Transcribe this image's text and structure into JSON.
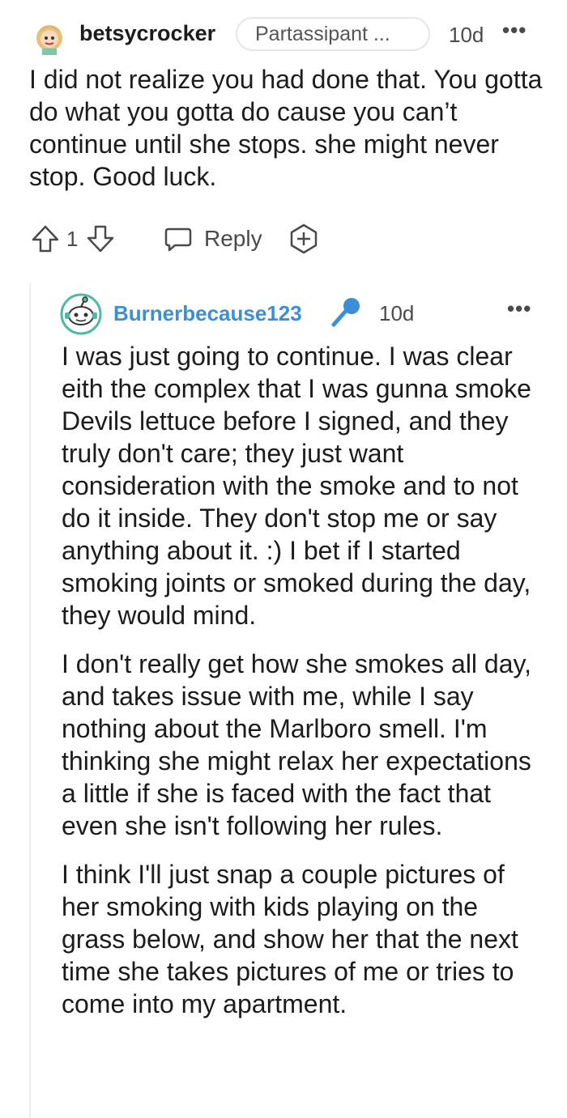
{
  "comment1": {
    "username": "betsycrocker",
    "flair": "Partassipant ...",
    "time": "10d",
    "more": "•••",
    "body": "I did not realize you had done that. You gotta do what you gotta do cause you can’t continue until she stops. she might never stop. Good luck.",
    "votes": "1",
    "reply_label": "Reply"
  },
  "comment2": {
    "username": "Burnerbecause123",
    "time": "10d",
    "more": "•••",
    "paragraphs": [
      "I was just going to continue. I was clear eith the complex that I was gunna smoke Devils lettuce before I signed, and they truly don't care; they just want consideration with the smoke and to not do it inside. They don't stop me or say anything about it. :) I bet if I started smoking joints or smoked during the day, they would mind.",
      "I don't really get how she smokes all day, and takes issue with me, while I say nothing about the Marlboro smell. I'm thinking she might relax her expectations a little if she is faced with the fact that even she isn't following her rules.",
      "I think I'll just snap a couple pictures of her smoking with kids playing on the grass below, and show her that the next time she takes pictures of me or tries to come into my apartment."
    ]
  },
  "colors": {
    "username_blue": "#3a8fd6",
    "text": "#1c1c1c",
    "meta": "#4a4a4a"
  }
}
